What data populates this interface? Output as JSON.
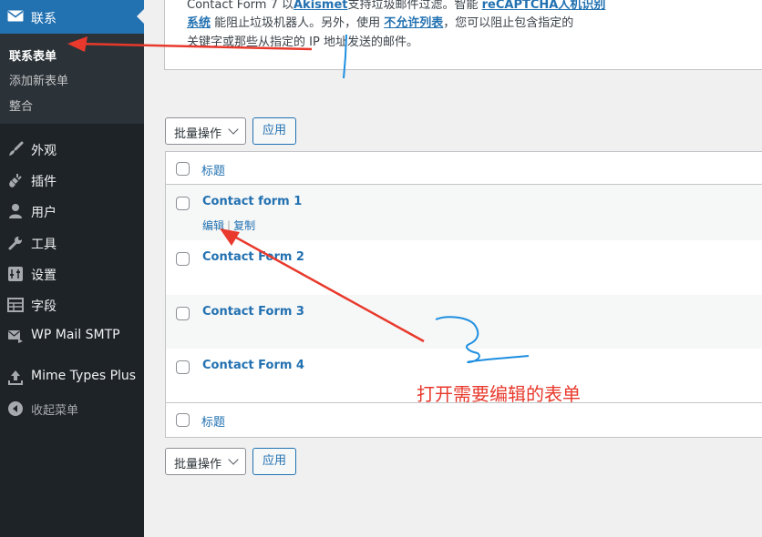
{
  "sidebar": {
    "current": {
      "label": "联系",
      "icon": "mail-icon"
    },
    "submenu": [
      {
        "label": "联系表单",
        "active": true
      },
      {
        "label": "添加新表单",
        "active": false
      },
      {
        "label": "整合",
        "active": false
      }
    ],
    "items": [
      {
        "label": "外观",
        "icon": "paintbrush-icon"
      },
      {
        "label": "插件",
        "icon": "plugin-icon"
      },
      {
        "label": "用户",
        "icon": "user-icon"
      },
      {
        "label": "工具",
        "icon": "wrench-icon"
      },
      {
        "label": "设置",
        "icon": "settings-icon"
      },
      {
        "label": "字段",
        "icon": "fields-icon"
      },
      {
        "label": "WP Mail SMTP",
        "icon": "mail-smtp-icon"
      },
      {
        "label": "Mime Types Plus",
        "icon": "upload-icon"
      },
      {
        "label": "收起菜单",
        "icon": "collapse-icon"
      }
    ]
  },
  "notice": {
    "line1_a": "Contact Form 7 以",
    "line1_link1": "Akismet",
    "line1_b": "支持垃圾邮件过滤。智能 ",
    "line1_link2": "reCAPTCHA人机识别",
    "line2_link": "系统",
    "line2_a": " 能阻止垃圾机器人。另外，使用 ",
    "line2_link2": "不允许列表",
    "line2_b": "，您可以阻止包含指定的",
    "line3": "关键字或那些从指定的 IP 地址发送的邮件。"
  },
  "bulk_actions": {
    "select_label": "批量操作",
    "apply_label": "应用"
  },
  "table": {
    "column_title": "标题",
    "rows": [
      {
        "title": "Contact form 1",
        "actions": [
          "编辑",
          "复制"
        ]
      },
      {
        "title": "Contact Form 2"
      },
      {
        "title": "Contact Form 3"
      },
      {
        "title": "Contact Form 4"
      }
    ]
  },
  "annotation": {
    "text": "打开需要编辑的表单",
    "color": "#e8392c"
  },
  "colors": {
    "sidebar": "#1d2327",
    "accent": "#2271b1",
    "annotation_red": "#e8392c",
    "annotation_blue": "#1e8fe0"
  }
}
